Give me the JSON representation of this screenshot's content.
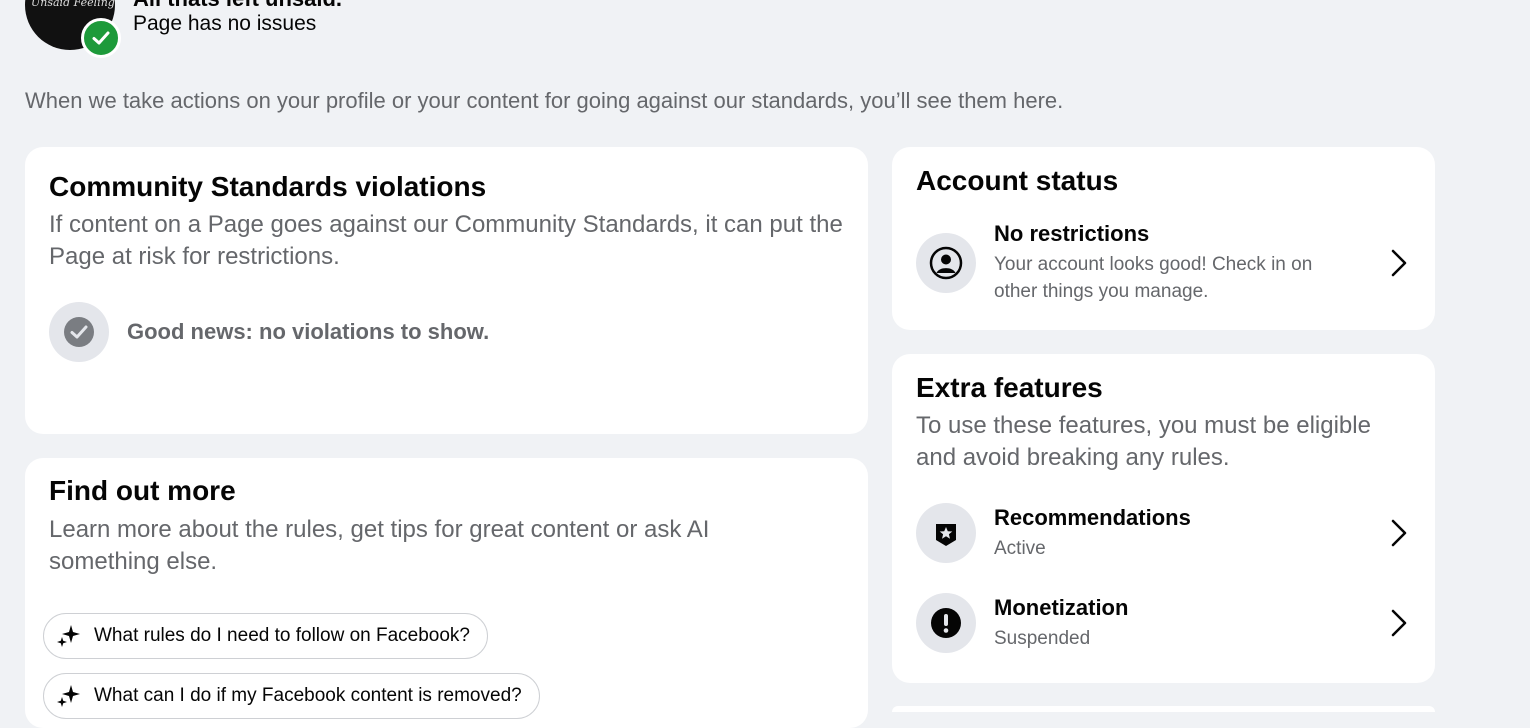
{
  "header": {
    "page_name": "All thats left unsaid.",
    "avatar_text": "Unsaid Feelings...",
    "status": "Page has no issues"
  },
  "intro": "When we take actions on your profile or your content for going against our standards, you’ll see them here.",
  "violations": {
    "title": "Community Standards violations",
    "description": "If content on a Page goes against our Community Standards, it can put the Page at risk for restrictions.",
    "empty_message": "Good news: no violations to show."
  },
  "find_out_more": {
    "title": "Find out more",
    "description": "Learn more about the rules, get tips for great content or ask AI something else.",
    "suggestions": [
      "What rules do I need to follow on Facebook?",
      "What can I do if my Facebook content is removed?"
    ]
  },
  "account_status": {
    "title": "Account status",
    "item": {
      "title": "No restrictions",
      "subtitle": "Your account looks good! Check in on other things you manage."
    }
  },
  "extra_features": {
    "title": "Extra features",
    "description": "To use these features, you must be eligible and avoid breaking any rules.",
    "items": [
      {
        "title": "Recommendations",
        "status": "Active"
      },
      {
        "title": "Monetization",
        "status": "Suspended"
      }
    ]
  },
  "colors": {
    "background": "#f0f2f5",
    "card": "#ffffff",
    "badge_green": "#1d9a3a",
    "secondary_text": "#65676b"
  }
}
